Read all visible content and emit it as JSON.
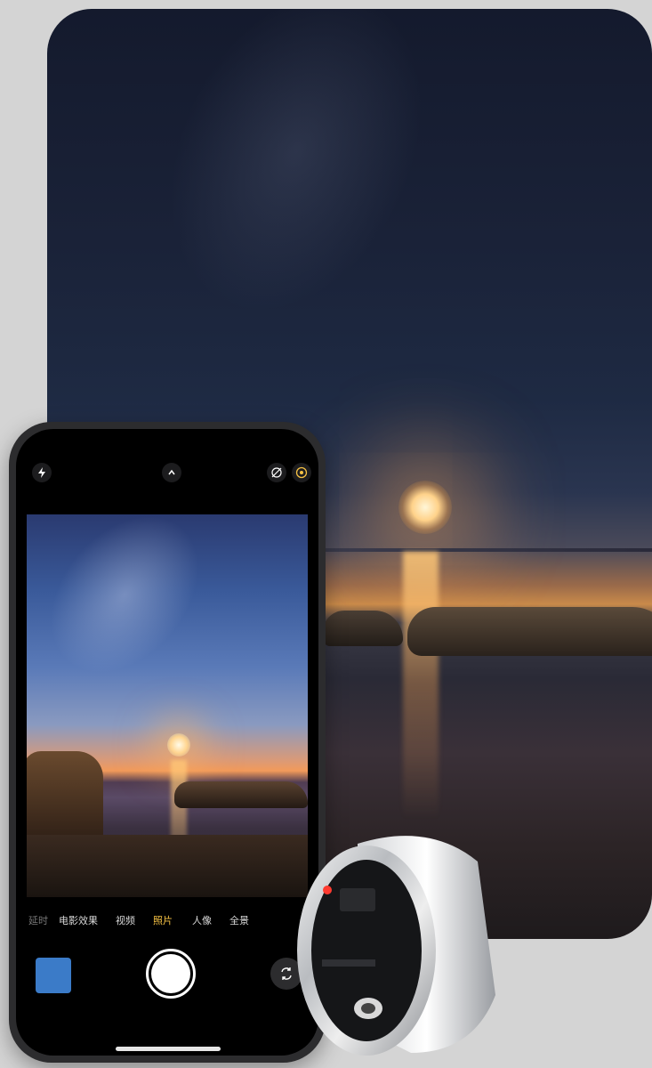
{
  "camera": {
    "modes": [
      "延时",
      "电影效果",
      "视频",
      "照片",
      "人像",
      "全景"
    ],
    "active_mode": "照片"
  },
  "icons": {
    "flash": "flash-icon",
    "expand": "chevron-up-icon",
    "live": "live-photo-off-icon",
    "night": "night-mode-icon",
    "flip": "camera-flip-icon"
  },
  "colors": {
    "active_mode": "#f6c244",
    "thumbnail": "#3b7bc8",
    "background": "#d4d4d4"
  }
}
